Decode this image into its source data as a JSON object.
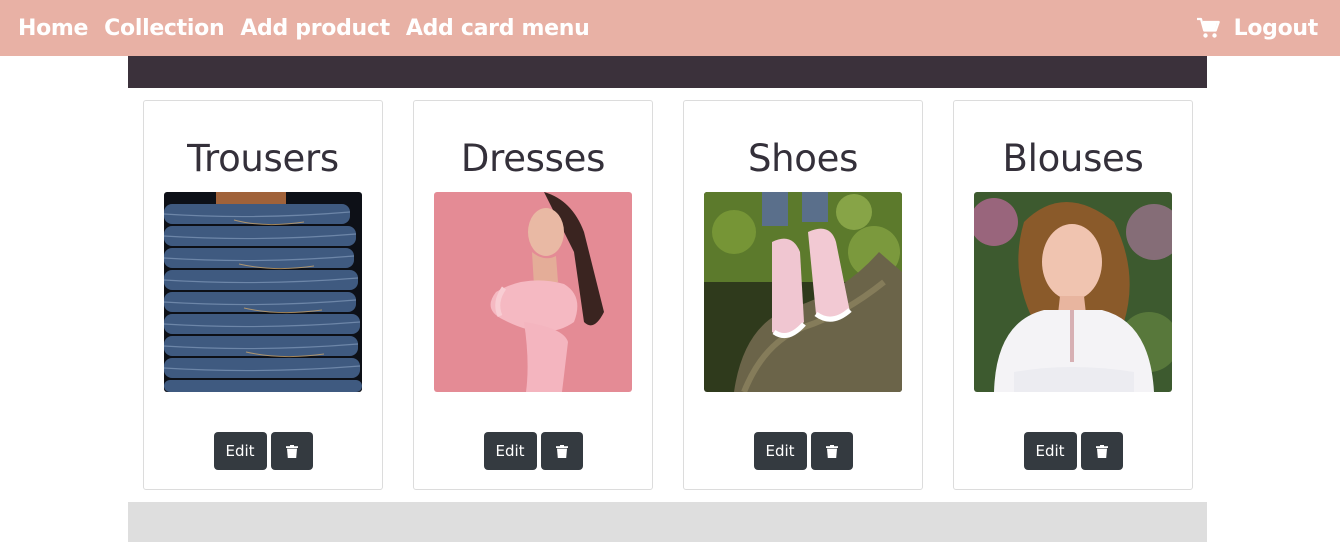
{
  "nav": {
    "links": [
      "Home",
      "Collection",
      "Add product",
      "Add card menu"
    ],
    "cart_icon": "shopping-cart-icon",
    "logout": "Logout"
  },
  "colors": {
    "navbar": "#e8b1a5",
    "band": "#3b313b",
    "button": "#343a40",
    "footer": "#dedede"
  },
  "cards": [
    {
      "title": "Trousers",
      "image": "stacked-jeans-photo",
      "edit": "Edit",
      "delete_icon": "trash-icon"
    },
    {
      "title": "Dresses",
      "image": "pink-dress-model-photo",
      "edit": "Edit",
      "delete_icon": "trash-icon"
    },
    {
      "title": "Shoes",
      "image": "pink-sneakers-photo",
      "edit": "Edit",
      "delete_icon": "trash-icon"
    },
    {
      "title": "Blouses",
      "image": "white-blouse-model-photo",
      "edit": "Edit",
      "delete_icon": "trash-icon"
    }
  ]
}
